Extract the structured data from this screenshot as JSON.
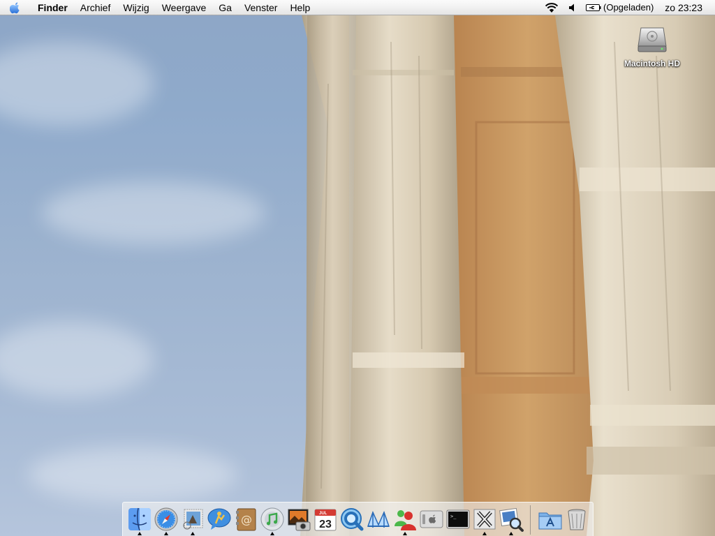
{
  "menubar": {
    "apple": "apple-icon",
    "items": [
      "Finder",
      "Archief",
      "Wijzig",
      "Weergave",
      "Ga",
      "Venster",
      "Help"
    ],
    "status": {
      "wifi": "wifi-icon",
      "volume": "volume-icon",
      "battery_text": "(Opgeladen)",
      "clock": "zo 23:23"
    }
  },
  "desktop": {
    "icons": [
      {
        "label": "Macintosh HD",
        "icon": "hard-drive-icon"
      }
    ]
  },
  "dock": {
    "apps": [
      {
        "icon": "finder-icon",
        "running": true
      },
      {
        "icon": "safari-icon",
        "running": true
      },
      {
        "icon": "mail-stamp-icon",
        "running": true
      },
      {
        "icon": "ichat-icon",
        "running": false
      },
      {
        "icon": "address-book-icon",
        "running": false
      },
      {
        "icon": "itunes-icon",
        "running": true
      },
      {
        "icon": "iphoto-icon",
        "running": false
      },
      {
        "icon": "ical-icon",
        "running": false,
        "text": "23",
        "month": "JUL"
      },
      {
        "icon": "quicktime-icon",
        "running": false
      },
      {
        "icon": "dictionary-icon",
        "running": false
      },
      {
        "icon": "messenger-icon",
        "running": true
      },
      {
        "icon": "system-preferences-icon",
        "running": false
      },
      {
        "icon": "terminal-icon",
        "running": false
      },
      {
        "icon": "x11-icon",
        "running": true
      },
      {
        "icon": "preview-icon",
        "running": true
      }
    ],
    "right": [
      {
        "icon": "applications-folder-icon"
      },
      {
        "icon": "trash-icon"
      }
    ]
  },
  "colors": {
    "sky": "#8ea6c6",
    "stone": "#d9cdb8",
    "wall": "#c7955d"
  }
}
